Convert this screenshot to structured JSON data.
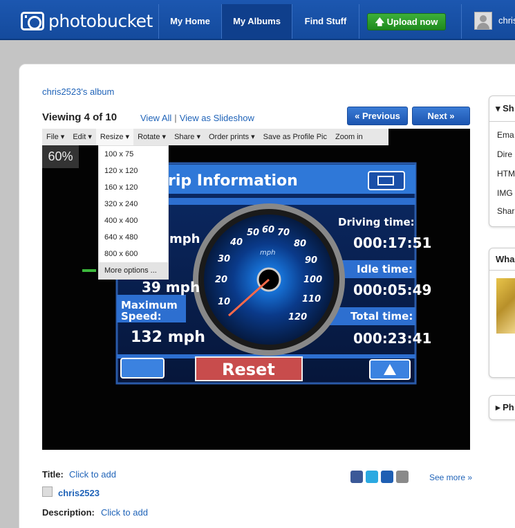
{
  "header": {
    "logo_text": "photobucket",
    "nav": [
      {
        "label": "My Home"
      },
      {
        "label": "My Albums"
      },
      {
        "label": "Find Stuff"
      }
    ],
    "upload_label": "Upload now",
    "username": "chris"
  },
  "album": {
    "link": "chris2523's album",
    "viewing": "Viewing 4 of 10",
    "view_all": "View All",
    "slideshow": "View as Slideshow",
    "previous": "« Previous",
    "next": "Next »",
    "zoom": "60%"
  },
  "toolbar": {
    "items": [
      "File ▾",
      "Edit ▾",
      "Resize ▾",
      "Rotate ▾",
      "Share ▾",
      "Order prints ▾",
      "Save as Profile Pic",
      "Zoom in"
    ]
  },
  "resize_menu": {
    "options": [
      "100 x 75",
      "120 x 120",
      "160 x 120",
      "320 x 240",
      "400 x 400",
      "640 x 480",
      "800 x 600"
    ],
    "more": "More options ..."
  },
  "photo_content": {
    "title": "rip Information",
    "driving_label": "Driving time:",
    "driving_value": "000:17:51",
    "idle_label": "Idle time:",
    "idle_value": "000:05:49",
    "total_label": "Total time:",
    "total_value": "000:23:41",
    "avg_value": "mph",
    "speed_value": "39 mph",
    "max_label1": "Maximum",
    "max_label2": "Speed:",
    "max_value": "132 mph",
    "reset": "Reset",
    "unit": "mph",
    "gauge_ticks": [
      "10",
      "20",
      "30",
      "40",
      "50",
      "60",
      "70",
      "80",
      "90",
      "100",
      "110",
      "120"
    ]
  },
  "details": {
    "title_label": "Title:",
    "title_link": "Click to add",
    "owner": "chris2523",
    "description_label": "Description:",
    "description_link": "Click to add",
    "see_more": "See more »"
  },
  "sidebar": {
    "share_title": "Sh",
    "share_items": [
      "Ema",
      "Dire",
      "HTM",
      "IMG",
      "Shar"
    ],
    "what_title": "Wha",
    "ph_title": "Ph"
  }
}
